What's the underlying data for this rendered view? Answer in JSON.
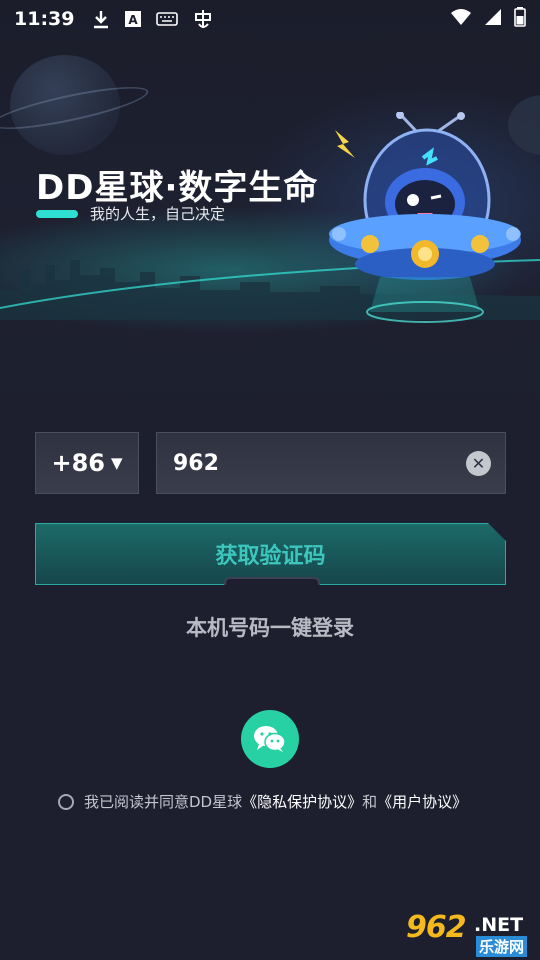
{
  "status_bar": {
    "time": "11:39",
    "icons_left": [
      "download-icon",
      "a-box-icon",
      "keyboard-icon",
      "bug-icon"
    ],
    "icons_right": [
      "wifi-icon",
      "signal-icon",
      "battery-icon"
    ]
  },
  "hero": {
    "title": "DD星球·数字生命",
    "subtitle": "我的人生，自己决定"
  },
  "login": {
    "country_code": "+86",
    "phone_value": "962",
    "get_code_label": "获取验证码",
    "quick_login_label": "本机号码一键登录"
  },
  "social": {
    "wechat_icon": "wechat-icon",
    "wechat_color": "#27d1a4"
  },
  "agreement": {
    "prefix": "我已阅读并同意DD星球",
    "privacy_link": "《隐私保护协议》",
    "and": "和",
    "user_link": "《用户协议》"
  },
  "watermark": {
    "number": "962",
    "net": ".NET",
    "cn": "乐游网"
  },
  "colors": {
    "background": "#1d1f2e",
    "accent": "#2fe0d2",
    "button_text": "#3cc7bd"
  }
}
